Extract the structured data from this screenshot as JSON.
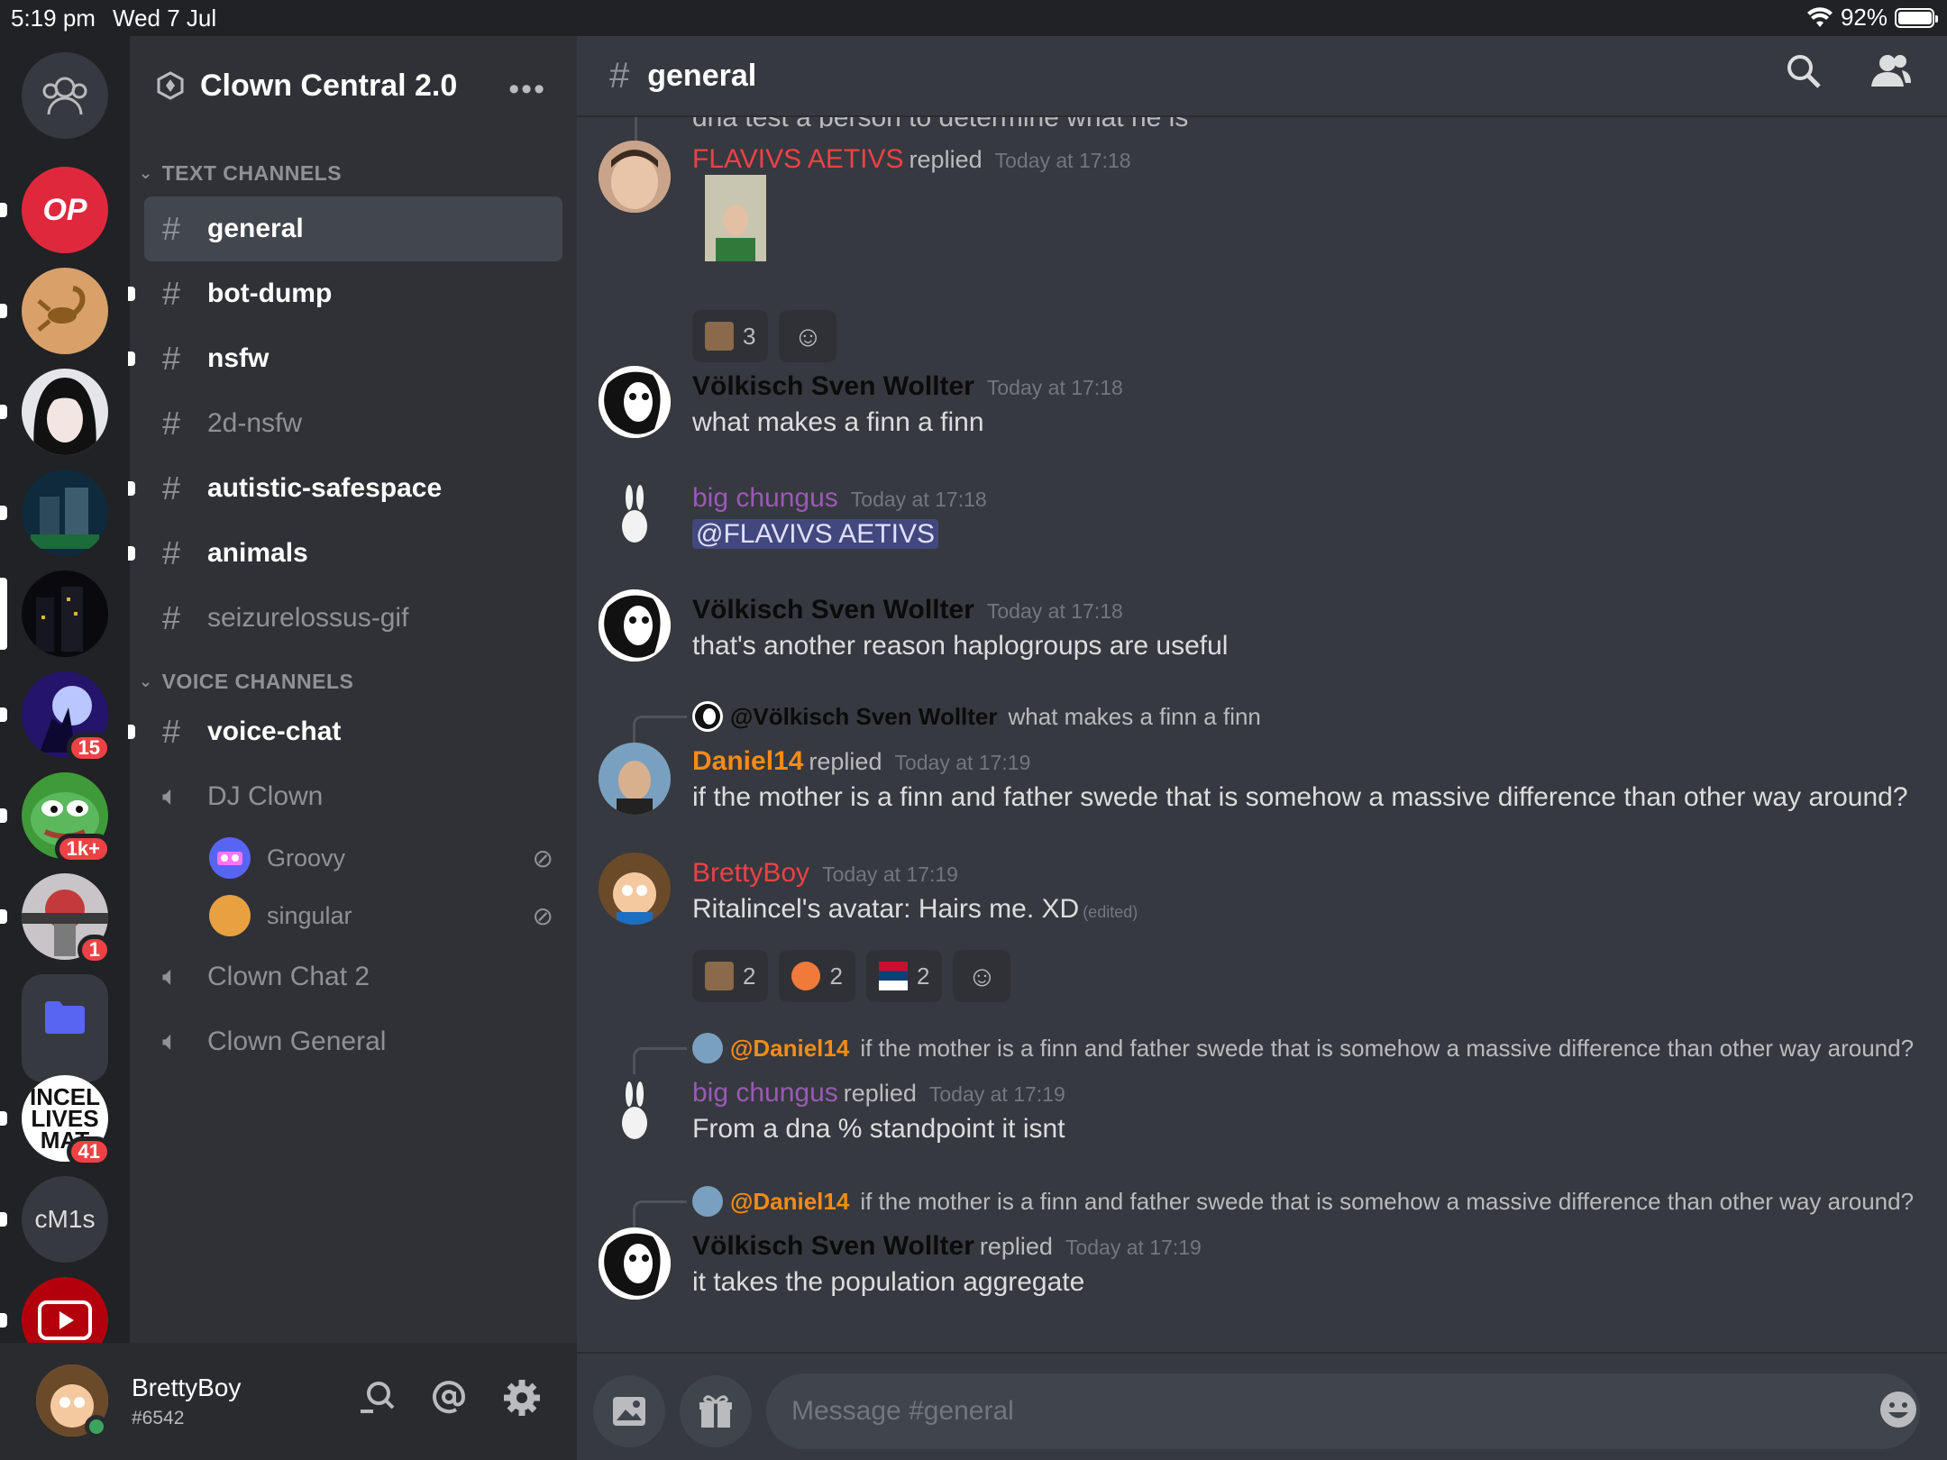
{
  "status_bar": {
    "time": "5:19 pm",
    "date": "Wed 7 Jul",
    "battery": "92%",
    "battery_fraction": 0.92
  },
  "server": {
    "name": "Clown Central 2.0",
    "more": "•••"
  },
  "rail": {
    "servers": [
      {
        "name": "OP",
        "badge": ""
      },
      {
        "name": "",
        "badge": ""
      },
      {
        "name": "",
        "badge": ""
      },
      {
        "name": "",
        "badge": ""
      },
      {
        "name": "",
        "badge": ""
      },
      {
        "name": "",
        "badge": "15"
      },
      {
        "name": "",
        "badge": "1k+"
      },
      {
        "name": "",
        "badge": "1"
      },
      {
        "name": "",
        "badge": ""
      },
      {
        "name": "INCEL LIVES MAT",
        "badge": "41"
      },
      {
        "name": "cM1s",
        "badge": ""
      },
      {
        "name": "",
        "badge": ""
      }
    ]
  },
  "sidebar": {
    "text_category": "TEXT CHANNELS",
    "voice_category": "VOICE CHANNELS",
    "text_channels": [
      "general",
      "bot-dump",
      "nsfw",
      "2d-nsfw",
      "autistic-safespace",
      "animals",
      "seizurelossus-gif"
    ],
    "voice_channels": [
      "voice-chat",
      "DJ Clown",
      "Clown Chat 2",
      "Clown General"
    ],
    "voice_users": [
      "Groovy",
      "singular"
    ]
  },
  "user_panel": {
    "username": "BrettyBoy",
    "tag": "#6542"
  },
  "chat": {
    "channel": "general",
    "clipped_text": "dna test a person to determine what he is",
    "messages": [
      {
        "author": "FLAVIVS AETIVS",
        "replied": "replied",
        "time": "Today at 17:18",
        "color": "#ed4245"
      },
      {
        "author": "Völkisch Sven Wollter",
        "time": "Today at 17:18",
        "text": "what makes a finn a finn",
        "color": "#0b0b0b"
      },
      {
        "author": "big chungus",
        "time": "Today at 17:18",
        "text": "@FLAVIVS AETIVS",
        "color": "#9b59b6"
      },
      {
        "author": "Völkisch Sven Wollter",
        "time": "Today at 17:18",
        "text": "that's another reason haplogroups are useful",
        "color": "#0b0b0b"
      },
      {
        "ref_name": "@Völkisch Sven Wollter",
        "ref_text": "what makes a finn a finn",
        "author": "Daniel14",
        "replied": "replied",
        "time": "Today at 17:19",
        "text": "if the mother is a finn and father swede that is somehow a massive difference than other way around?",
        "color": "#f58b16"
      },
      {
        "author": "BrettyBoy",
        "time": "Today at 17:19",
        "text": "Ritalincel's avatar: Hairs me. XD",
        "edited": "(edited)",
        "color": "#ed4245"
      },
      {
        "ref_name": "@Daniel14",
        "ref_text": "if the mother is a finn and father swede that is somehow a massive difference than other way around?",
        "author": "big chungus",
        "replied": "replied",
        "time": "Today at 17:19",
        "text": "From a dna % standpoint it isnt",
        "color": "#9b59b6"
      },
      {
        "ref_name": "@Daniel14",
        "ref_text": "if the mother is a finn and father swede that is somehow a massive difference than other way around?",
        "author": "Völkisch Sven Wollter",
        "replied": "replied",
        "time": "Today at 17:19",
        "text": "it takes the population aggregate",
        "color": "#0b0b0b"
      }
    ],
    "reactions_1": [
      {
        "count": "3"
      }
    ],
    "reactions_2": [
      {
        "count": "2"
      },
      {
        "count": "2"
      },
      {
        "count": "2"
      }
    ]
  },
  "composer": {
    "placeholder": "Message #general"
  }
}
